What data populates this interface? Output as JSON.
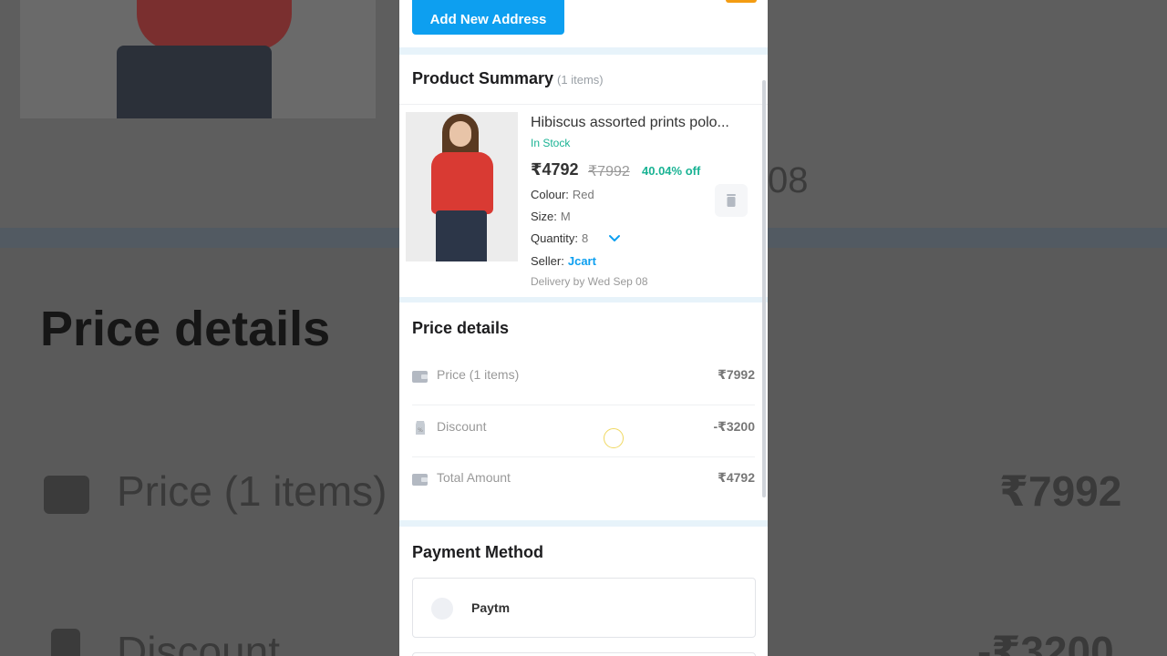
{
  "background": {
    "title": "Price details",
    "price_label": "Price (1 items)",
    "price_value": "₹7992",
    "partial_text": "08",
    "discount_label": "Discount",
    "discount_value": "-₹3200"
  },
  "address": {
    "add_button_label": "Add New Address"
  },
  "product_summary": {
    "title": "Product Summary",
    "count": "(1 items)",
    "item": {
      "name": "Hibiscus assorted prints polo...",
      "stock": "In Stock",
      "price": "₹4792",
      "original_price": "₹7992",
      "discount": "40.04% off",
      "colour_label": "Colour:",
      "colour": "Red",
      "size_label": "Size:",
      "size": "M",
      "quantity_label": "Quantity:",
      "quantity": "8",
      "seller_label": "Seller:",
      "seller": "Jcart",
      "delivery": "Delivery by Wed Sep 08",
      "icons": {
        "quantity": "chevron-down-icon",
        "remove": "trash-icon"
      }
    }
  },
  "price_details": {
    "title": "Price details",
    "rows": [
      {
        "label": "Price (1 items)",
        "value": "₹7992",
        "icon": "wallet-icon"
      },
      {
        "label": "Discount",
        "value": "-₹3200",
        "icon": "tag-icon"
      },
      {
        "label": "Total Amount",
        "value": "₹4792",
        "icon": "wallet-icon"
      }
    ]
  },
  "payment": {
    "title": "Payment Method",
    "options": [
      {
        "name": "Paytm"
      }
    ]
  },
  "colors": {
    "accent": "#0d9ff0",
    "success": "#1ab394",
    "separator": "#e7f3fa"
  }
}
